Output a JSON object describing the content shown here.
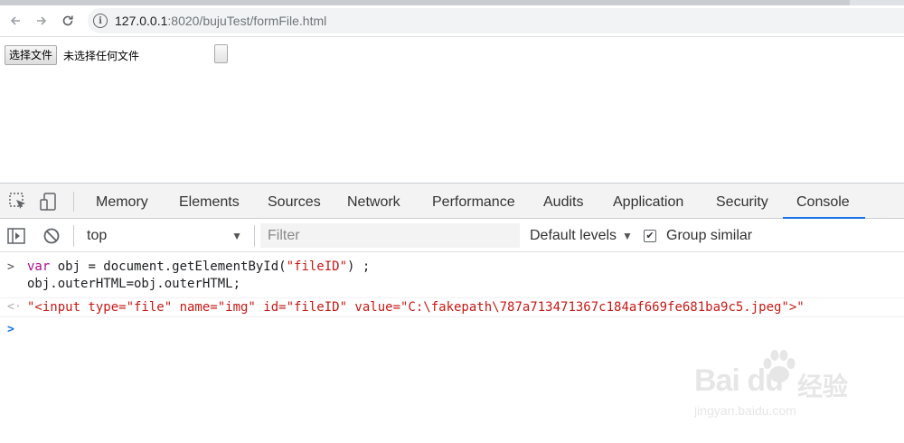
{
  "browser": {
    "url_host": "127.0.0.1",
    "url_rest": ":8020/bujuTest/formFile.html"
  },
  "page": {
    "file_button_label": "选择文件",
    "file_status": "未选择任何文件"
  },
  "devtools": {
    "tabs": [
      "Memory",
      "Elements",
      "Sources",
      "Network",
      "Performance",
      "Audits",
      "Application",
      "Security",
      "Console"
    ],
    "active_tab": "Console",
    "console_bar": {
      "context": "top",
      "filter_placeholder": "Filter",
      "levels": "Default levels",
      "group_similar": "Group similar",
      "group_similar_checked": true
    },
    "console": {
      "input_line1_kw": "var",
      "input_line1_mid": " obj = document.getElementById(",
      "input_line1_str": "\"fileID\"",
      "input_line1_end": ") ;",
      "input_line2": "obj.outerHTML=obj.outerHTML;",
      "result": "\"<input type=\"file\" name=\"img\" id=\"fileID\" value=\"C:\\fakepath\\787a713471367c184af669fe681ba9c5.jpeg\">\""
    }
  },
  "watermark": {
    "brand": "Bai du",
    "cn": "经验",
    "sub": "jingyan.baidu.com"
  }
}
